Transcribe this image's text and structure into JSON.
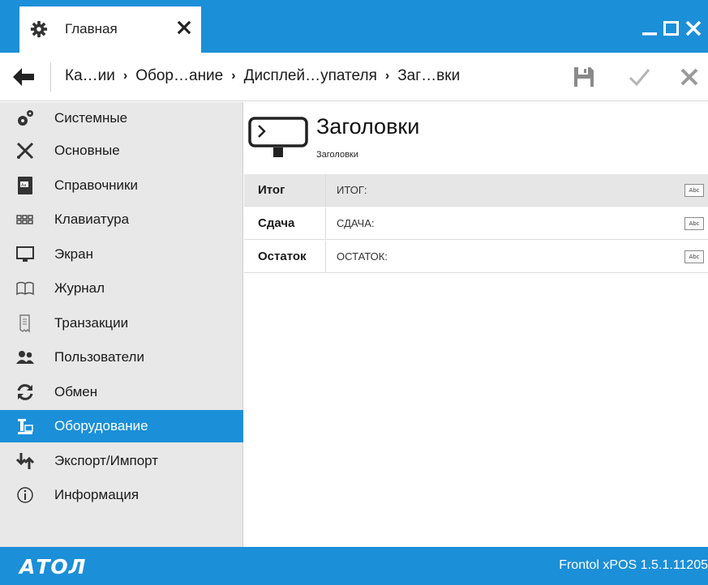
{
  "window": {
    "tab_label": "Главная"
  },
  "breadcrumb": {
    "items": [
      "Ка…ии",
      "Обор…ание",
      "Дисплей…упателя",
      "Заг…вки"
    ]
  },
  "sidebar": {
    "items": [
      {
        "label": "Системные",
        "icon": "gears-icon"
      },
      {
        "label": "Основные",
        "icon": "tools-icon"
      },
      {
        "label": "Справочники",
        "icon": "book-icon"
      },
      {
        "label": "Клавиатура",
        "icon": "keyboard-icon"
      },
      {
        "label": "Экран",
        "icon": "monitor-icon"
      },
      {
        "label": "Журнал",
        "icon": "journal-icon"
      },
      {
        "label": "Транзакции",
        "icon": "receipt-icon"
      },
      {
        "label": "Пользователи",
        "icon": "users-icon"
      },
      {
        "label": "Обмен",
        "icon": "sync-icon"
      },
      {
        "label": "Оборудование",
        "icon": "equipment-icon",
        "active": true
      },
      {
        "label": "Экспорт/Импорт",
        "icon": "import-export-icon"
      },
      {
        "label": "Информация",
        "icon": "info-icon"
      }
    ]
  },
  "page": {
    "title": "Заголовки",
    "subtitle": "Заголовки"
  },
  "rows": [
    {
      "label": "Итог",
      "value": "ИТОГ:",
      "badge": "Abc"
    },
    {
      "label": "Сдача",
      "value": "СДАЧА:",
      "badge": "Abc"
    },
    {
      "label": "Остаток",
      "value": "ОСТАТОК:",
      "badge": "Abc"
    }
  ],
  "footer": {
    "logo": "АТОЛ",
    "version": "Frontol xPOS 1.5.1.11205"
  },
  "colors": {
    "accent": "#1b8fd8",
    "sidebar_bg": "#e8e8e8"
  }
}
